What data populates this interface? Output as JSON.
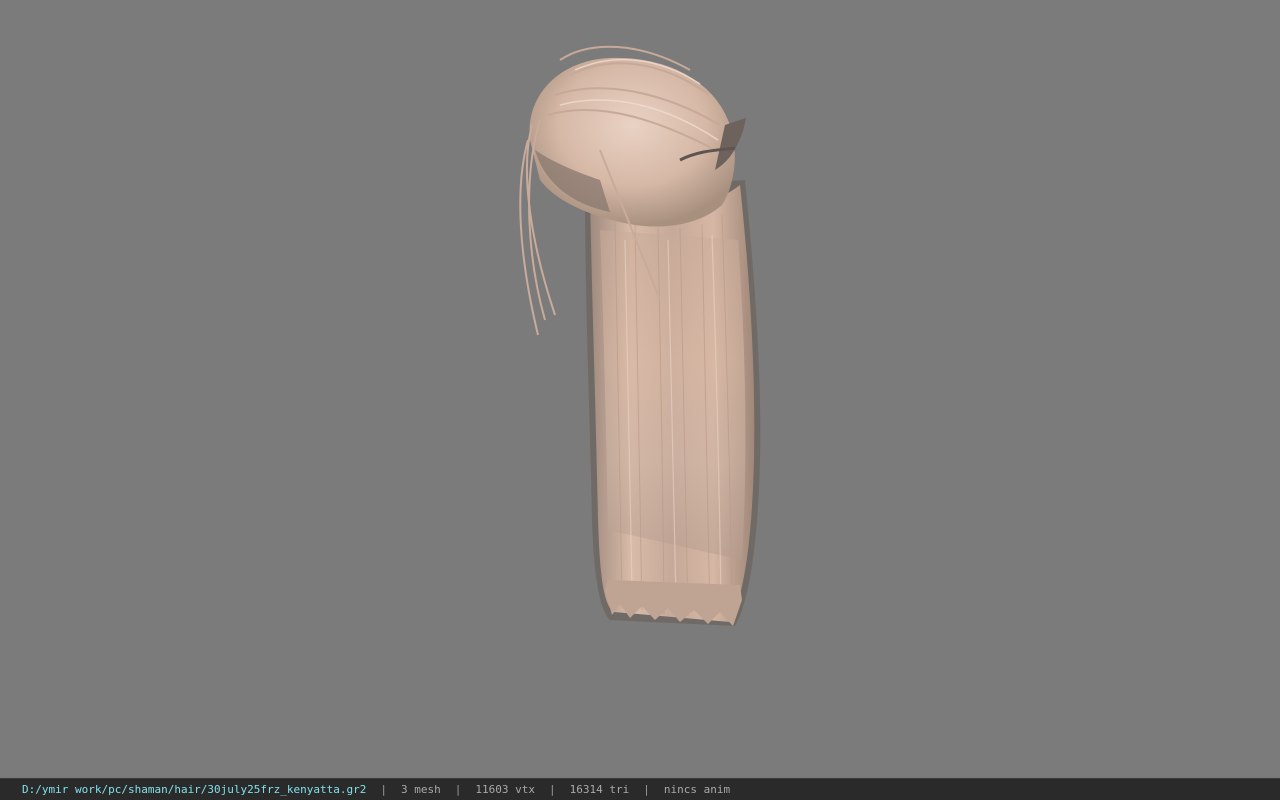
{
  "viewport": {
    "background_color": "#7b7b7b",
    "model": {
      "subject": "long-hair-mesh",
      "hair_color": "#d8b9a6"
    }
  },
  "statusbar": {
    "file_path": "D:/ymir work/pc/shaman/hair/30july25frz_kenyatta.gr2",
    "separator": "|",
    "mesh_count": "3 mesh",
    "vertex_count": "11603 vtx",
    "triangle_count": "16314 tri",
    "anim_status": "nincs anim",
    "path_color": "#7fe0ea"
  }
}
